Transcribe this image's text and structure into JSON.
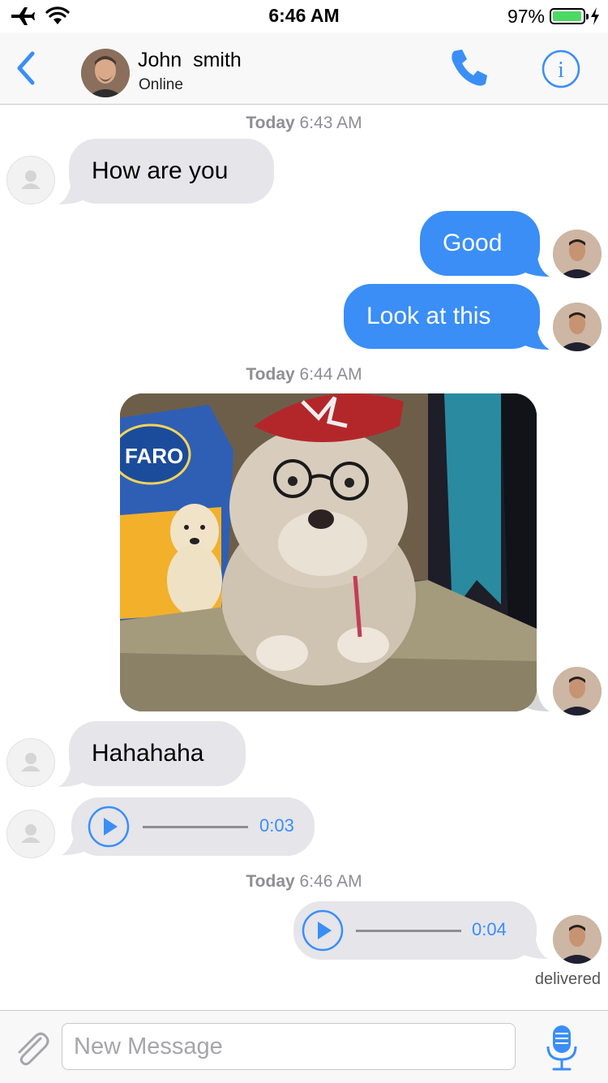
{
  "status_bar": {
    "time": "6:46 AM",
    "battery": "97%",
    "battery_level": 0.97,
    "icons": [
      "airplane-icon",
      "wifi-icon",
      "battery-icon",
      "charging-icon"
    ]
  },
  "header": {
    "contact_name": "John  smith",
    "status": "Online",
    "icons": [
      "back-chevron-icon",
      "phone-icon",
      "info-icon"
    ]
  },
  "messages": {
    "ts1": {
      "day": "Today",
      "time": "6:43 AM"
    },
    "m1": "How are you",
    "m2": "Good",
    "m3": "Look at this",
    "ts2": {
      "day": "Today",
      "time": "6:44 AM"
    },
    "m5": "Hahahaha",
    "audio1": {
      "duration": "0:03"
    },
    "ts3": {
      "day": "Today",
      "time": "6:46 AM"
    },
    "audio2": {
      "duration": "0:04"
    },
    "delivered": "delivered"
  },
  "composer": {
    "placeholder": "New Message",
    "icons": [
      "paperclip-icon",
      "microphone-icon"
    ]
  },
  "colors": {
    "accent": "#3a8ef6",
    "incoming_bubble": "#e5e5ea",
    "outgoing_bubble": "#3a8ef6",
    "battery": "#4cd964"
  }
}
